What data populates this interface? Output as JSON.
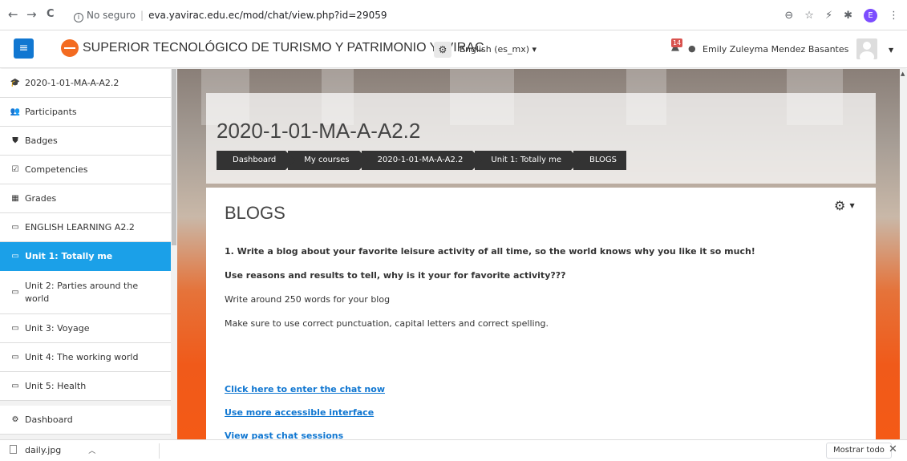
{
  "browser": {
    "back": "←",
    "forward": "→",
    "reload": "C",
    "security": "No seguro",
    "url": "eva.yavirac.edu.ec/mod/chat/view.php?id=29059",
    "profile_initial": "E"
  },
  "navbar": {
    "menu_icon": "≡",
    "site_name": "SUPERIOR TECNOLÓGICO DE TURISMO Y PATRIMONIO YAVIRAC",
    "language": "English (es_mx) ▾",
    "notification_count": "14",
    "user_name": "Emily Zuleyma Mendez Basantes"
  },
  "sidebar": {
    "items": [
      {
        "icon": "graduation-cap-icon",
        "glyph": "🎓",
        "label": "2020-1-01-MA-A-A2.2"
      },
      {
        "icon": "users-icon",
        "glyph": "👥",
        "label": "Participants"
      },
      {
        "icon": "shield-icon",
        "glyph": "⛊",
        "label": "Badges"
      },
      {
        "icon": "check-square-icon",
        "glyph": "☑",
        "label": "Competencies"
      },
      {
        "icon": "table-icon",
        "glyph": "▦",
        "label": "Grades"
      },
      {
        "icon": "folder-icon",
        "glyph": "▭",
        "label": "ENGLISH LEARNING A2.2"
      },
      {
        "icon": "folder-icon",
        "glyph": "▭",
        "label": "Unit 1: Totally me"
      },
      {
        "icon": "folder-icon",
        "glyph": "▭",
        "label": "Unit 2: Parties around the world"
      },
      {
        "icon": "folder-icon",
        "glyph": "▭",
        "label": "Unit 3: Voyage"
      },
      {
        "icon": "folder-icon",
        "glyph": "▭",
        "label": "Unit 4: The working world"
      },
      {
        "icon": "folder-icon",
        "glyph": "▭",
        "label": "Unit 5: Health"
      },
      {
        "icon": "dashboard-icon",
        "glyph": "⚙",
        "label": "Dashboard"
      }
    ],
    "active_index": 6
  },
  "header": {
    "course_title": "2020-1-01-MA-A-A2.2",
    "breadcrumb": [
      "Dashboard",
      "My courses",
      "2020-1-01-MA-A-A2.2",
      "Unit 1: Totally me",
      "BLOGS"
    ]
  },
  "content": {
    "heading": "BLOGS",
    "paragraphs": [
      "1. Write a blog about your favorite leisure activity of all time, so the world knows why you like it so much!",
      "Use reasons and results to tell, why is it your for favorite activity???",
      "Write around 250 words for your blog",
      "Make sure to use correct punctuation, capital letters and correct spelling."
    ],
    "links": [
      "Click here to enter the chat now",
      "Use more accessible interface",
      "View past chat sessions"
    ]
  },
  "download_bar": {
    "file_name": "daily.jpg",
    "show_all": "Mostrar todo",
    "close": "✕"
  }
}
